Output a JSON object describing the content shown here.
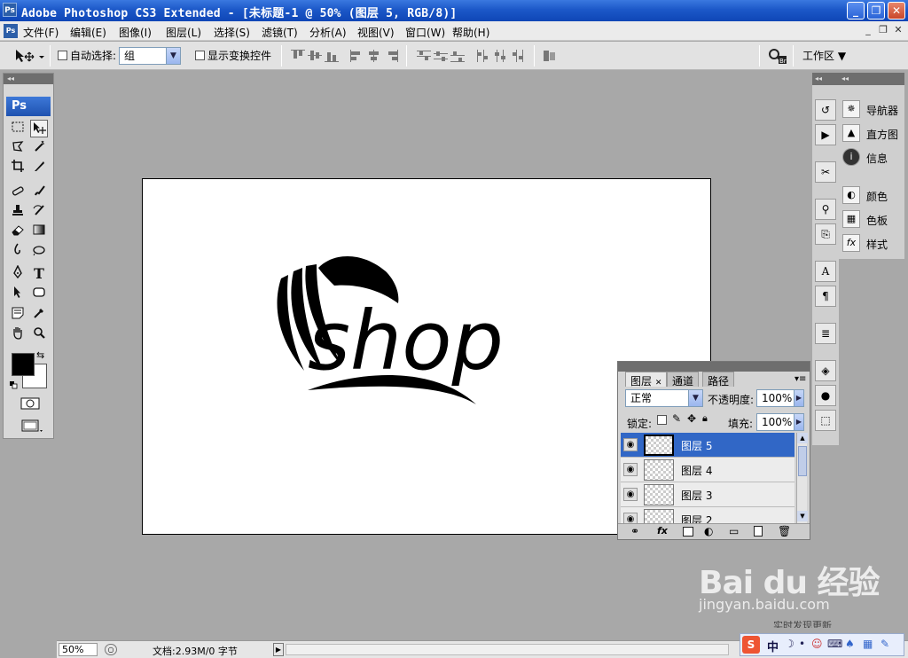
{
  "window": {
    "title": "Adobe Photoshop CS3 Extended - [未标题-1 @ 50% (图层 5, RGB/8)]",
    "app_icon_text": "Ps",
    "doc_icon_text": "Ps",
    "minimize": "_",
    "maximize": "❐",
    "close": "✕"
  },
  "menu": {
    "items": [
      "文件(F)",
      "编辑(E)",
      "图像(I)",
      "图层(L)",
      "选择(S)",
      "滤镜(T)",
      "分析(A)",
      "视图(V)",
      "窗口(W)",
      "帮助(H)"
    ],
    "doc_minimize": "_",
    "doc_restore": "❐",
    "doc_close": "✕"
  },
  "options": {
    "auto_select_label": "自动选择:",
    "auto_select_value": "组",
    "show_transform_label": "显示变换控件",
    "workspace_label": "工作区 ▼"
  },
  "tools": {
    "ps_logo": "Ps",
    "grip": "◂◂"
  },
  "dock": {
    "grip": "◂◂",
    "panels": [
      {
        "label": "导航器",
        "icon": "navigator-icon"
      },
      {
        "label": "直方图",
        "icon": "histogram-icon"
      },
      {
        "label": "信息",
        "icon": "info-icon"
      },
      {
        "label": "颜色",
        "icon": "color-icon"
      },
      {
        "label": "色板",
        "icon": "swatches-icon"
      },
      {
        "label": "样式",
        "icon": "styles-icon"
      }
    ]
  },
  "layers_panel": {
    "tabs": [
      "图层",
      "通道",
      "路径"
    ],
    "tab_close": "✕",
    "blend_mode": "正常",
    "opacity_label": "不透明度:",
    "opacity_value": "100%",
    "lock_label": "锁定:",
    "fill_label": "填充:",
    "fill_value": "100%",
    "layers": [
      {
        "name": "图层 5",
        "active": true
      },
      {
        "name": "图层 4",
        "active": false
      },
      {
        "name": "图层 3",
        "active": false
      },
      {
        "name": "图层 2",
        "active": false
      }
    ]
  },
  "canvas": {
    "logo_text": "shop"
  },
  "status": {
    "zoom": "50%",
    "doc_info": "文档:2.93M/0 字节"
  },
  "watermark": {
    "brand": "Bai du 经验",
    "url": "jingyan.baidu.com",
    "news": "实时发现更新"
  }
}
